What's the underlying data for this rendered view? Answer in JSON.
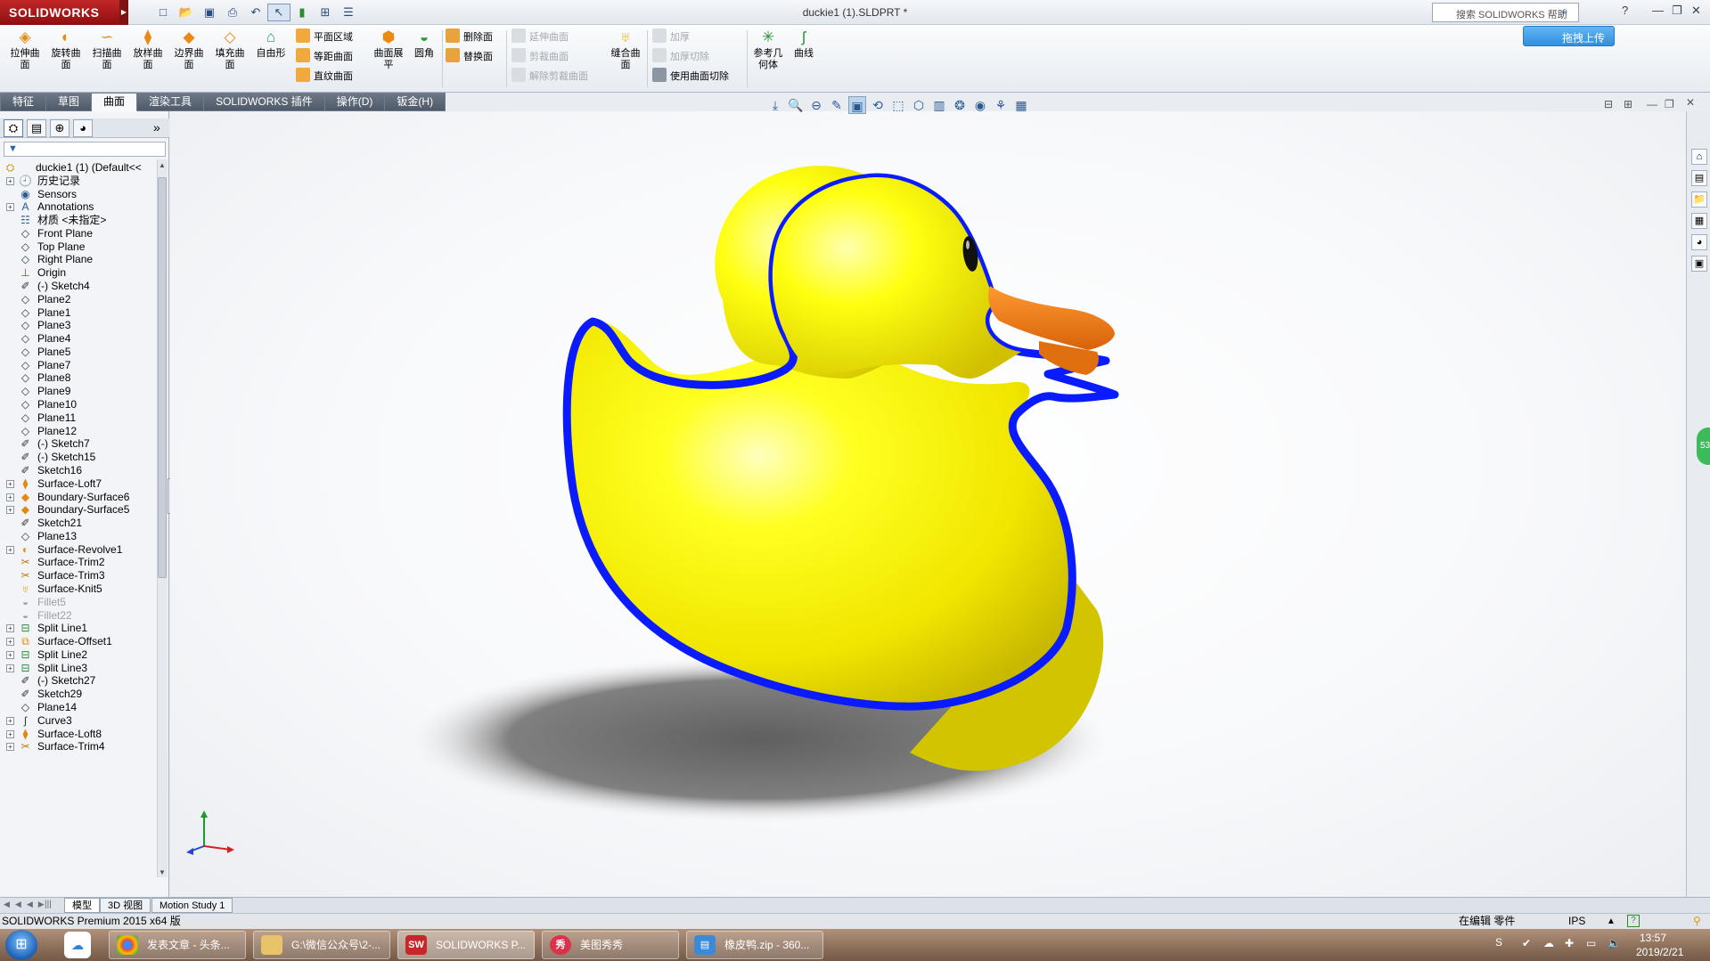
{
  "app": {
    "logo_text": "SOLIDWORKS",
    "document_title": "duckie1 (1).SLDPRT *",
    "search_placeholder": "搜索 SOLIDWORKS 帮助",
    "accent_color": "#c8262a"
  },
  "quick_access": {
    "icons": [
      "new-icon",
      "open-icon",
      "save-icon",
      "print-icon",
      "undo-icon",
      "select-icon",
      "rebuild-icon",
      "file-properties-icon",
      "options-icon"
    ]
  },
  "cloud_upload": {
    "label": "拖拽上传"
  },
  "ribbon": {
    "big_buttons": [
      {
        "label": "拉伸曲面"
      },
      {
        "label": "旋转曲面"
      },
      {
        "label": "扫描曲面"
      },
      {
        "label": "放样曲面"
      },
      {
        "label": "边界曲面"
      },
      {
        "label": "填充曲面"
      },
      {
        "label": "自由形"
      }
    ],
    "group2": {
      "planar": "平面区域",
      "offset": "等距曲面",
      "ruled": "直纹曲面"
    },
    "flatten": "曲面展平",
    "fillet": "圆角",
    "group3": {
      "delete_face": "删除面",
      "replace_face": "替换面"
    },
    "group4": {
      "extend": "延伸曲面",
      "trim": "剪裁曲面",
      "untrim": "解除剪裁曲面"
    },
    "knit": "缝合曲面",
    "group5": {
      "thicken": "加厚",
      "thicken_cut": "加厚切除",
      "surface_cut": "使用曲面切除"
    },
    "ref_geometry": "参考几何体",
    "curves": "曲线"
  },
  "tabs": [
    {
      "label": "特征"
    },
    {
      "label": "草图"
    },
    {
      "label": "曲面",
      "active": true
    },
    {
      "label": "渲染工具"
    },
    {
      "label": "SOLIDWORKS 插件"
    },
    {
      "label": "操作(D)"
    },
    {
      "label": "钣金(H)"
    }
  ],
  "feature_tree": {
    "root": {
      "name": "duckie1 (1)",
      "config": "(Default<<"
    },
    "items": [
      {
        "label": "历史记录",
        "icon": "history-icon",
        "expandable": true
      },
      {
        "label": "Sensors",
        "icon": "sensors-icon",
        "expandable": false
      },
      {
        "label": "Annotations",
        "icon": "annotations-icon",
        "expandable": true
      },
      {
        "label": "材质 <未指定>",
        "icon": "material-icon",
        "expandable": false
      },
      {
        "label": "Front Plane",
        "icon": "plane-icon",
        "expandable": false
      },
      {
        "label": "Top Plane",
        "icon": "plane-icon",
        "expandable": false
      },
      {
        "label": "Right Plane",
        "icon": "plane-icon",
        "expandable": false
      },
      {
        "label": "Origin",
        "icon": "origin-icon",
        "expandable": false
      },
      {
        "label": "(-) Sketch4",
        "icon": "sketch-icon",
        "expandable": false
      },
      {
        "label": "Plane2",
        "icon": "plane-icon",
        "expandable": false
      },
      {
        "label": "Plane1",
        "icon": "plane-icon",
        "expandable": false
      },
      {
        "label": "Plane3",
        "icon": "plane-icon",
        "expandable": false
      },
      {
        "label": "Plane4",
        "icon": "plane-icon",
        "expandable": false
      },
      {
        "label": "Plane5",
        "icon": "plane-icon",
        "expandable": false
      },
      {
        "label": "Plane7",
        "icon": "plane-icon",
        "expandable": false
      },
      {
        "label": "Plane8",
        "icon": "plane-icon",
        "expandable": false
      },
      {
        "label": "Plane9",
        "icon": "plane-icon",
        "expandable": false
      },
      {
        "label": "Plane10",
        "icon": "plane-icon",
        "expandable": false
      },
      {
        "label": "Plane11",
        "icon": "plane-icon",
        "expandable": false
      },
      {
        "label": "Plane12",
        "icon": "plane-icon",
        "expandable": false
      },
      {
        "label": "(-) Sketch7",
        "icon": "sketch-icon",
        "expandable": false
      },
      {
        "label": "(-) Sketch15",
        "icon": "sketch-icon",
        "expandable": false
      },
      {
        "label": "Sketch16",
        "icon": "sketch-icon",
        "expandable": false
      },
      {
        "label": "Surface-Loft7",
        "icon": "loft-icon",
        "expandable": true
      },
      {
        "label": "Boundary-Surface6",
        "icon": "boundary-surface-icon",
        "expandable": true
      },
      {
        "label": "Boundary-Surface5",
        "icon": "boundary-surface-icon",
        "expandable": true
      },
      {
        "label": "Sketch21",
        "icon": "sketch-icon",
        "expandable": false
      },
      {
        "label": "Plane13",
        "icon": "plane-icon",
        "expandable": false
      },
      {
        "label": "Surface-Revolve1",
        "icon": "revolve-icon",
        "expandable": true
      },
      {
        "label": "Surface-Trim2",
        "icon": "trim-icon",
        "expandable": false
      },
      {
        "label": "Surface-Trim3",
        "icon": "trim-icon",
        "expandable": false
      },
      {
        "label": "Surface-Knit5",
        "icon": "knit-icon",
        "expandable": false
      },
      {
        "label": "Fillet5",
        "icon": "fillet-icon",
        "expandable": false,
        "suppressed": true
      },
      {
        "label": "Fillet22",
        "icon": "fillet-icon",
        "expandable": false,
        "suppressed": true
      },
      {
        "label": "Split Line1",
        "icon": "split-line-icon",
        "expandable": true
      },
      {
        "label": "Surface-Offset1",
        "icon": "offset-icon",
        "expandable": true
      },
      {
        "label": "Split Line2",
        "icon": "split-line-icon",
        "expandable": true
      },
      {
        "label": "Split Line3",
        "icon": "split-line-icon",
        "expandable": true
      },
      {
        "label": "(-) Sketch27",
        "icon": "sketch-icon",
        "expandable": false
      },
      {
        "label": "Sketch29",
        "icon": "sketch-icon",
        "expandable": false
      },
      {
        "label": "Plane14",
        "icon": "plane-icon",
        "expandable": false
      },
      {
        "label": "Curve3",
        "icon": "curve-icon",
        "expandable": true
      },
      {
        "label": "Surface-Loft8",
        "icon": "loft-icon",
        "expandable": true
      },
      {
        "label": "Surface-Trim4",
        "icon": "trim-icon",
        "expandable": true
      }
    ]
  },
  "model": {
    "body_color": "#ffee00",
    "edge_color": "#0018ff",
    "beak_color": "#f07a10"
  },
  "bottom_tabs": [
    {
      "label": "模型",
      "active": true
    },
    {
      "label": "3D 视图"
    },
    {
      "label": "Motion Study 1"
    }
  ],
  "status": {
    "product": "SOLIDWORKS Premium 2015 x64 版",
    "mode": "在编辑 零件",
    "units": "IPS"
  },
  "taskbar": {
    "tasks": [
      {
        "label": "发表文章 - 头条...",
        "icon": "chrome-icon"
      },
      {
        "label": "G:\\微信公众号\\2-...",
        "icon": "folder-icon"
      },
      {
        "label": "SOLIDWORKS P...",
        "icon": "solidworks-icon",
        "active": true
      },
      {
        "label": "美图秀秀",
        "icon": "meitu-icon"
      },
      {
        "label": "橡皮鸭.zip - 360...",
        "icon": "zip-icon"
      }
    ],
    "clock_time": "13:57",
    "clock_date": "2019/2/21",
    "side_badge": "53"
  }
}
